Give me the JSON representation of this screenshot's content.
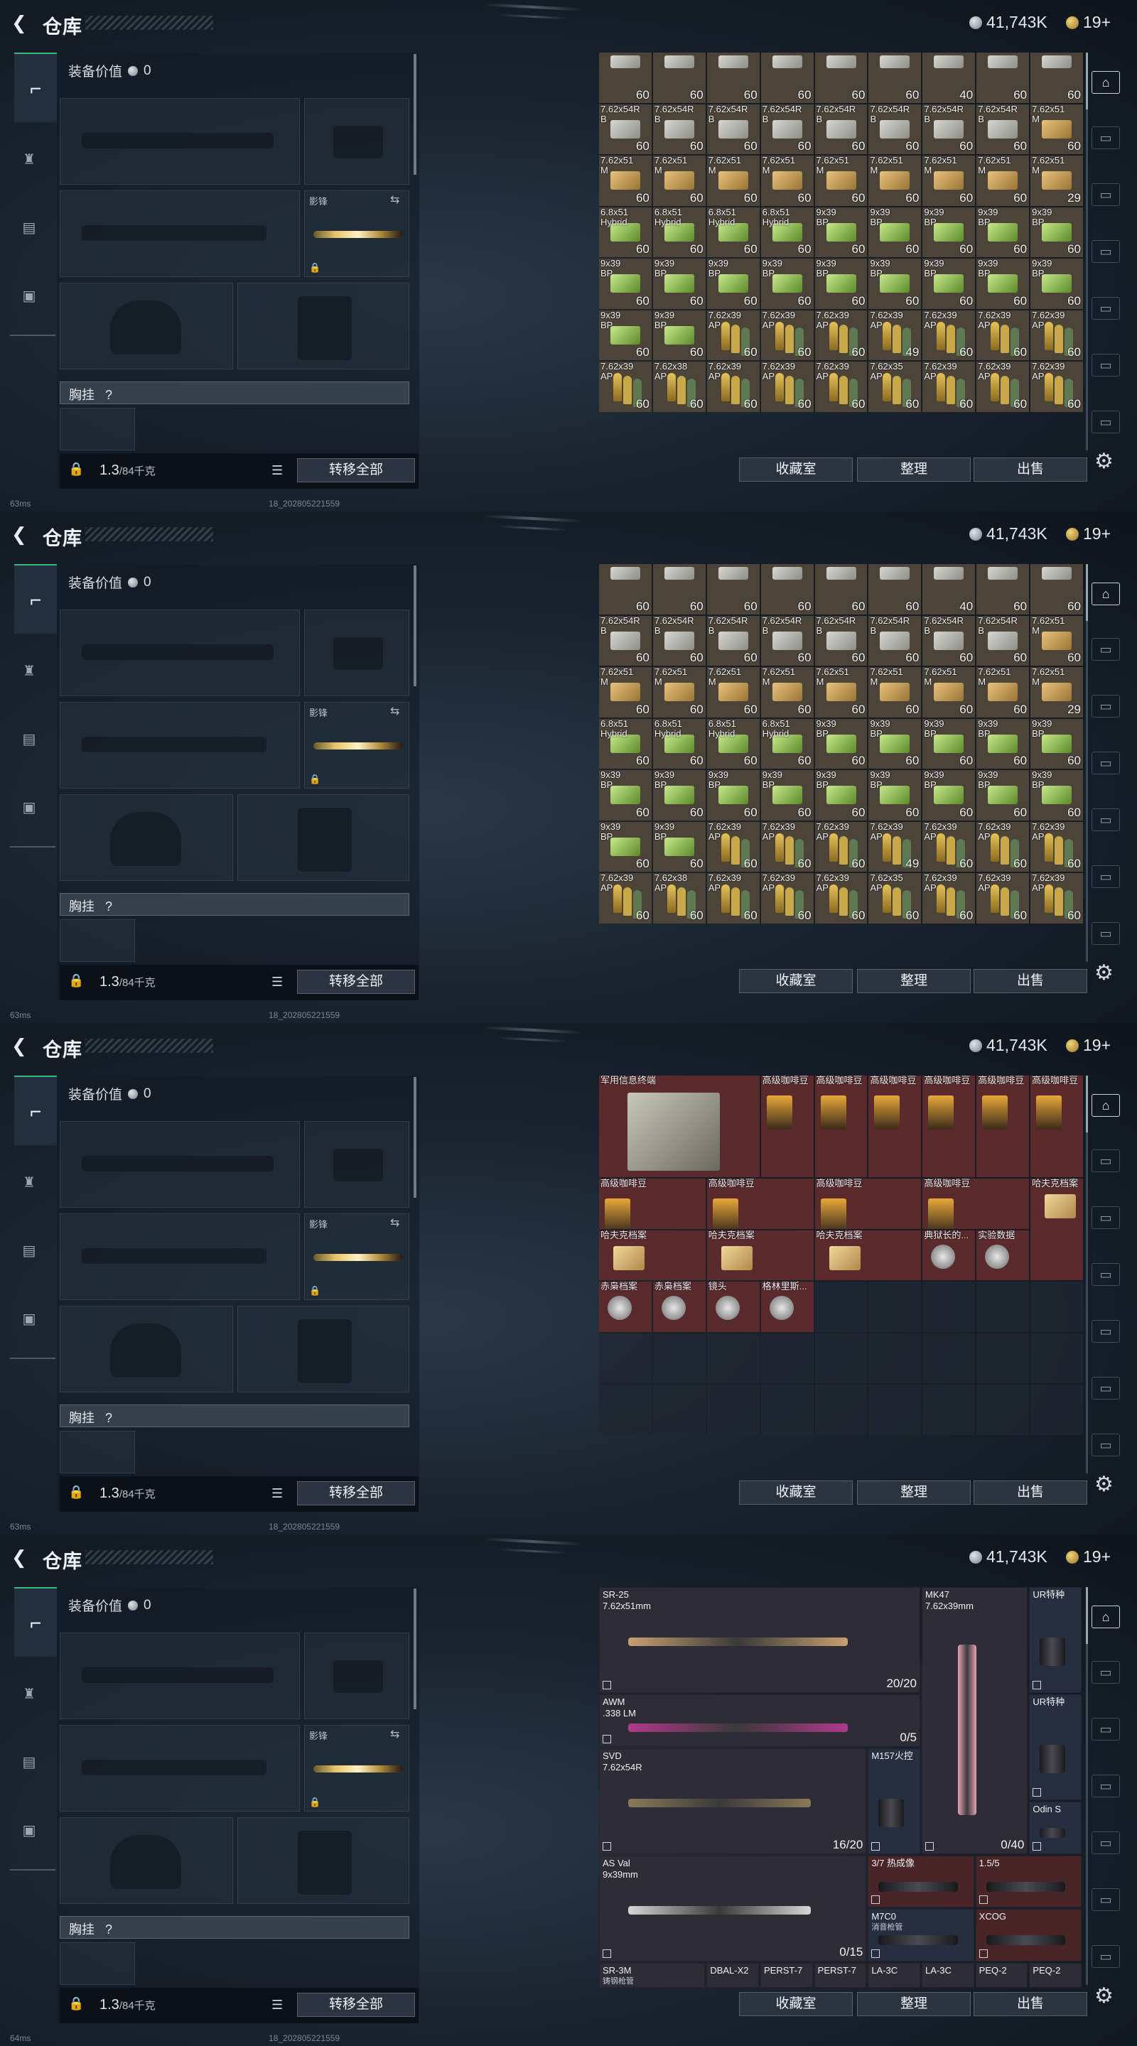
{
  "app": {
    "title": "仓库",
    "currency": "41,743K",
    "tickets": "19+"
  },
  "left": {
    "equip_value_label": "装备价值",
    "equip_value": "0",
    "knife_label": "影锋",
    "vest_label": "胸挂",
    "vest_help": "?",
    "weight_value": "1.3",
    "weight_cap": "/84千克",
    "transfer_all": "转移全部"
  },
  "actions": {
    "collection": "收藏室",
    "sort": "整理",
    "sell": "出售"
  },
  "status": {
    "ping1": "63ms",
    "ping2": "63ms",
    "ping3": "63ms",
    "ping4": "64ms",
    "build": "18_202805221559"
  },
  "ammo_grid": [
    [
      "",
      "",
      "",
      "",
      "",
      "",
      "",
      "",
      ""
    ],
    [
      "7.62x54R\nB",
      "7.62x54R\nB",
      "7.62x54R\nB",
      "7.62x54R\nB",
      "7.62x54R\nB",
      "7.62x54R\nB",
      "7.62x54R\nB",
      "7.62x54R\nB",
      "7.62x51\nM"
    ],
    [
      "7.62x51\nM",
      "7.62x51\nM",
      "7.62x51\nM",
      "7.62x51\nM",
      "7.62x51\nM",
      "7.62x51\nM",
      "7.62x51\nM",
      "7.62x51\nM",
      "7.62x51\nM"
    ],
    [
      "6.8x51\nHybrid",
      "6.8x51\nHybrid",
      "6.8x51\nHybrid",
      "6.8x51\nHybrid",
      "9x39\nBP",
      "9x39\nBP",
      "9x39\nBP",
      "9x39\nBP",
      "9x39\nBP"
    ],
    [
      "9x39\nBP",
      "9x39\nBP",
      "9x39\nBP",
      "9x39\nBP",
      "9x39\nBP",
      "9x39\nBP",
      "9x39\nBP",
      "9x39\nBP",
      "9x39\nBP"
    ],
    [
      "9x39\nBP",
      "9x39\nBP",
      "7.62x39\nAP",
      "7.62x39\nAP",
      "7.62x39\nAP",
      "7.62x39\nAP",
      "7.62x39\nAP",
      "7.62x39\nAP",
      "7.62x39\nAP"
    ],
    [
      "7.62x39\nAP",
      "7.62x38\nAP",
      "7.62x39\nAP",
      "7.62x39\nAP",
      "7.62x39\nAP",
      "7.62x35\nAP",
      "7.62x39\nAP",
      "7.62x39\nAP",
      "7.62x39\nAP"
    ]
  ],
  "ammo_counts": [
    [
      "60",
      "60",
      "60",
      "60",
      "60",
      "60",
      "40",
      "60",
      "60"
    ],
    [
      "60",
      "60",
      "60",
      "60",
      "60",
      "60",
      "60",
      "60",
      "60"
    ],
    [
      "60",
      "60",
      "60",
      "60",
      "60",
      "60",
      "60",
      "60",
      "29"
    ],
    [
      "60",
      "60",
      "60",
      "60",
      "60",
      "60",
      "60",
      "60",
      "60"
    ],
    [
      "60",
      "60",
      "60",
      "60",
      "60",
      "60",
      "60",
      "60",
      "60"
    ],
    [
      "60",
      "60",
      "60",
      "60",
      "60",
      "49",
      "60",
      "60",
      "60"
    ],
    [
      "60",
      "60",
      "60",
      "60",
      "60",
      "60",
      "60",
      "60",
      "60"
    ]
  ],
  "misc_items": {
    "terminal": "军用信息终端",
    "coffee": "高级咖啡豆",
    "hafu": "哈夫克档案",
    "hafu_short": "哈夫克档案",
    "drive": "典狱长的...",
    "experiment": "实验数据",
    "red_file": "赤枭档案",
    "lens": "镜头",
    "gear_item": "格林里斯..."
  },
  "weapons": {
    "sr25": {
      "name": "SR-25",
      "cal": "7.62x51mm",
      "count": "20/20"
    },
    "mk47": {
      "name": "MK47",
      "cal": "7.62x39mm",
      "count": "0/40"
    },
    "ur1": {
      "name": "UR特种"
    },
    "ur2": {
      "name": "UR特种"
    },
    "awm": {
      "name": "AWM",
      "cal": ".338 LM",
      "count": "0/5"
    },
    "svd": {
      "name": "SVD",
      "cal": "7.62x54R",
      "count": "16/20"
    },
    "m157": {
      "name": "M157火控"
    },
    "odin": {
      "name": "Odin S"
    },
    "asval": {
      "name": "AS Val",
      "cal": "9x39mm",
      "count": "0/15"
    },
    "thermal": {
      "name": "3/7 热成像"
    },
    "scope15": {
      "name": "1.5/5"
    },
    "m7c0": {
      "name": "M7C0",
      "sub": "消音枪管"
    },
    "xcog": {
      "name": "XCOG"
    },
    "sr3m": {
      "name": "SR-3M",
      "sub": "铸钢枪管"
    },
    "dbal": {
      "name": "DBAL-X2"
    },
    "perst1": {
      "name": "PERST-7"
    },
    "perst2": {
      "name": "PERST-7"
    },
    "la1": {
      "name": "LA-3C"
    },
    "la2": {
      "name": "LA-3C"
    },
    "peq1": {
      "name": "PEQ-2"
    },
    "peq2": {
      "name": "PEQ-2"
    }
  }
}
